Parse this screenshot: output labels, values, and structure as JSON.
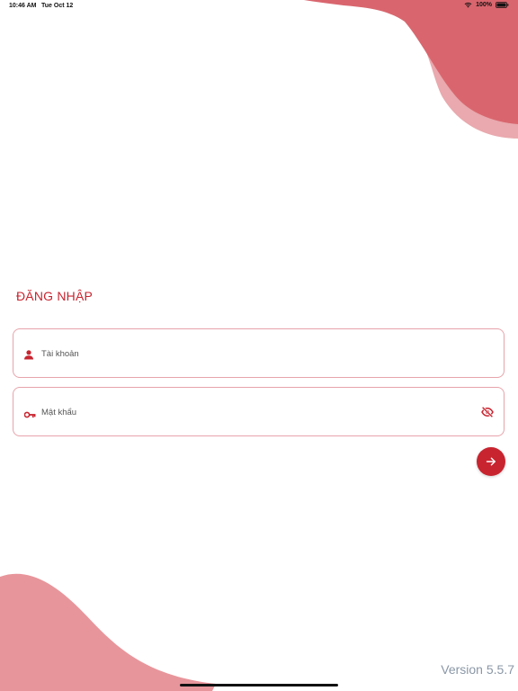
{
  "status_bar": {
    "time": "10:46 AM",
    "date": "Tue Oct 12",
    "battery": "100%",
    "icons": [
      "wifi-icon",
      "battery-icon"
    ]
  },
  "login": {
    "title": "ĐĂNG NHẬP",
    "username": {
      "placeholder": "Tài khoản",
      "value": "",
      "icon": "user-icon"
    },
    "password": {
      "placeholder": "Mật khẩu",
      "value": "",
      "icon": "key-icon",
      "toggle_icon": "eye-off-icon"
    },
    "submit_icon": "arrow-right-icon"
  },
  "footer": {
    "version": "Version 5.5.7"
  },
  "colors": {
    "accent": "#c8242f",
    "blob_dark": "#d9666e",
    "blob_light": "#e9a9ae",
    "field_border": "#e7a3ab",
    "version_text": "#8a97a6"
  }
}
